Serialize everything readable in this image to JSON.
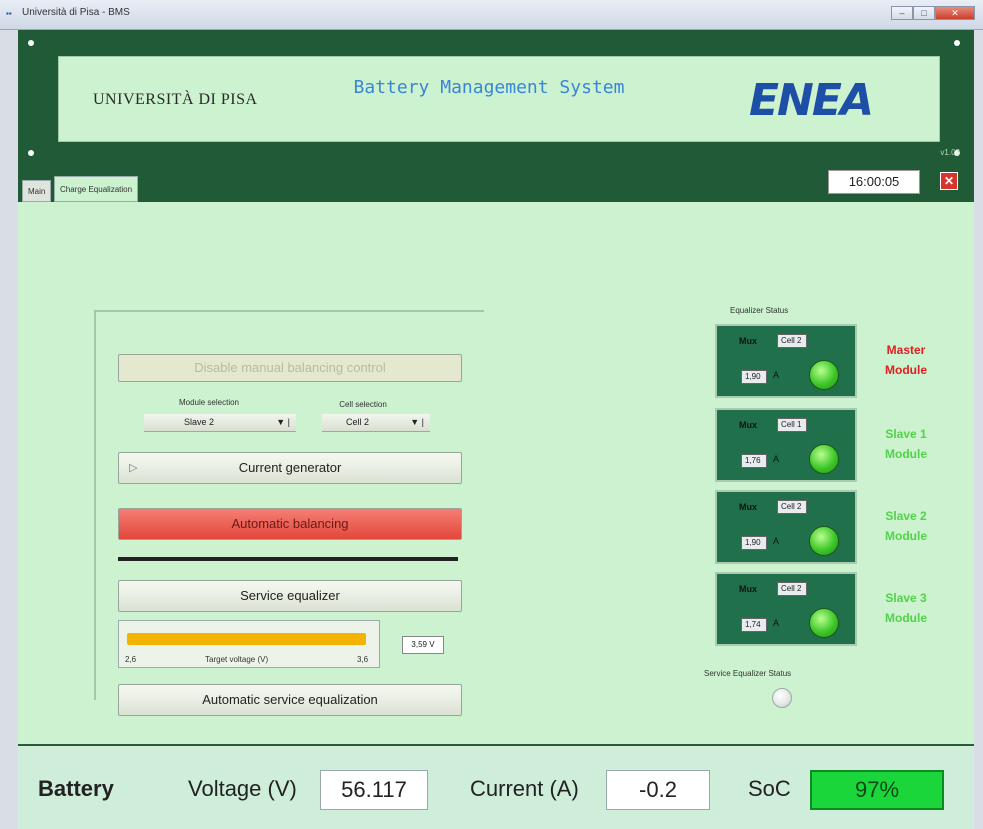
{
  "window": {
    "title": "Università di Pisa - BMS",
    "controls": [
      "–",
      "□",
      "✕"
    ]
  },
  "header": {
    "university": "UNIVERSITÀ DI PISA",
    "app_title": "Battery Management System",
    "logo": "ENEA",
    "version": "v1.03"
  },
  "tabs": [
    {
      "label": "Main",
      "active": false
    },
    {
      "label": "Charge Equalization",
      "active": true
    }
  ],
  "clock": "16:00:05",
  "stop_icon": "✕",
  "controls": {
    "disable_manual": "Disable manual balancing control",
    "module_selection_label": "Module selection",
    "module_selection_value": "Slave 2",
    "cell_selection_label": "Cell selection",
    "cell_selection_value": "Cell 2",
    "current_generator": "Current generator",
    "automatic_balancing": "Automatic balancing",
    "service_equalizer": "Service equalizer",
    "slider": {
      "min_label": "2,6",
      "max_label": "3,6",
      "caption": "Target voltage (V)",
      "level_fraction": 0.97,
      "value_box": "3,59 V"
    },
    "automatic_service_equalization": "Automatic service equalization"
  },
  "equalizer": {
    "title": "Equalizer Status",
    "modules": [
      {
        "mux_label": "Mux",
        "cell": "Cell 2",
        "current": "1,90",
        "unit": "A",
        "name_line1": "Master",
        "name_line2": "Module",
        "accent": "#e02020"
      },
      {
        "mux_label": "Mux",
        "cell": "Cell 1",
        "current": "1,76",
        "unit": "A",
        "name_line1": "Slave 1",
        "name_line2": "Module",
        "accent": "#52d34a"
      },
      {
        "mux_label": "Mux",
        "cell": "Cell 2",
        "current": "1,90",
        "unit": "A",
        "name_line1": "Slave 2",
        "name_line2": "Module",
        "accent": "#52d34a"
      },
      {
        "mux_label": "Mux",
        "cell": "Cell 2",
        "current": "1,74",
        "unit": "A",
        "name_line1": "Slave 3",
        "name_line2": "Module",
        "accent": "#52d34a"
      }
    ],
    "service_status_label": "Service Equalizer Status"
  },
  "footer": {
    "battery_label": "Battery",
    "voltage_label": "Voltage (V)",
    "voltage_value": "56.117",
    "current_label": "Current (A)",
    "current_value": "-0.2",
    "soc_label": "SoC",
    "soc_value": "97%"
  }
}
